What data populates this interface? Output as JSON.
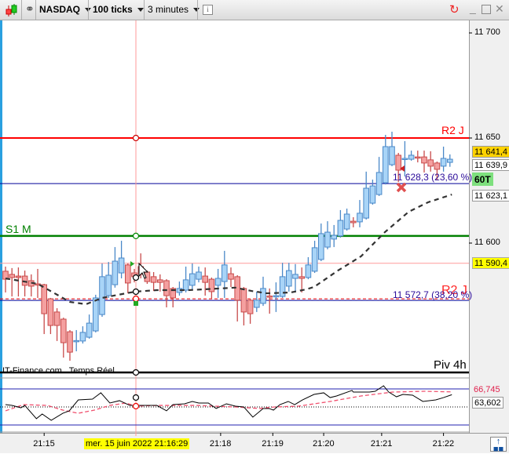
{
  "toolbar": {
    "symbol": "NASDAQ",
    "ticks": "100 ticks",
    "timeframe": "3 minutes",
    "info_icon": "info-icon",
    "icons": [
      "candlestick-icon",
      "link-icon",
      "refresh-icon",
      "minimize-icon",
      "maximize-icon",
      "close-icon"
    ]
  },
  "price_axis": {
    "ticks": [
      {
        "price": 11700,
        "label": "11 700"
      },
      {
        "price": 11650,
        "label": "11 650"
      },
      {
        "price": 11600,
        "label": "11 600"
      }
    ],
    "boxes": [
      {
        "label": "11 641,4",
        "price": 11641.4,
        "color": "#ffd200"
      },
      {
        "label": "11 639,9",
        "price": 11639.9,
        "color": "#ffffff"
      },
      {
        "label": "60T",
        "color": "#7ee07e"
      },
      {
        "label": "11 623,1",
        "price": 11623.1,
        "color": "#ffffff"
      },
      {
        "label": "11 590,4",
        "price": 11590.4,
        "color": "#ffff00"
      }
    ]
  },
  "levels": {
    "r2j": {
      "label": "R2 J",
      "price": 11650,
      "color": "#ff0000"
    },
    "s1m": {
      "label": "S1 M",
      "price": 11603.4,
      "color": "#008000"
    },
    "fib1": {
      "label": "11 628,3 (23,60 %)",
      "price": 11628.3,
      "color": "#000099"
    },
    "fib2": {
      "label": "11 572,7 (38,20 %)",
      "price": 11572.7,
      "color": "#000099"
    },
    "r2j_overlap": {
      "label": "R2 J",
      "color": "#ff0000"
    },
    "piv4h": {
      "label": "Piv 4h",
      "color": "#000000"
    },
    "crosshair_price": 11590.4
  },
  "watermark": "IT-Finance.com   Temps Réel",
  "colors": {
    "up": "#a8d4f7",
    "up_border": "#4a88c8",
    "down": "#f4a0a0",
    "down_border": "#c84a4a",
    "ma": "#333333"
  },
  "candles": [
    [
      11586.6,
      11588.8,
      11576.5,
      11582.8
    ],
    [
      11585.1,
      11588.1,
      11574.6,
      11583.6
    ],
    [
      11584.3,
      11588.4,
      11574.6,
      11583.6
    ],
    [
      11584.3,
      11586.9,
      11574.6,
      11579.9
    ],
    [
      11582.1,
      11585.1,
      11574.6,
      11579.5
    ],
    [
      11580.6,
      11587.7,
      11573.9,
      11580.4
    ],
    [
      11580.2,
      11580.6,
      11556.7,
      11566.4
    ],
    [
      11573.5,
      11573.9,
      11556.7,
      11560.8
    ],
    [
      11567.2,
      11569.0,
      11553.4,
      11560.8
    ],
    [
      11563.8,
      11564.5,
      11545.5,
      11552.6
    ],
    [
      11557.8,
      11558.6,
      11544.0,
      11548.1
    ],
    [
      11553.2,
      11558.6,
      11548.5,
      11553.6
    ],
    [
      11553.4,
      11560.4,
      11552.2,
      11557.5
    ],
    [
      11555.2,
      11566.0,
      11554.5,
      11561.9
    ],
    [
      11558.2,
      11575.4,
      11557.5,
      11573.9
    ],
    [
      11566.0,
      11590.3,
      11564.9,
      11584.0
    ],
    [
      11575.0,
      11591.0,
      11573.9,
      11584.7
    ],
    [
      11580.2,
      11598.1,
      11578.8,
      11591.4
    ],
    [
      11585.8,
      11601.1,
      11583.2,
      11592.9
    ],
    [
      11589.6,
      11590.3,
      11576.1,
      11581.0
    ],
    [
      11585.8,
      11587.7,
      11581.3,
      11584.0
    ],
    [
      11588.8,
      11595.1,
      11583.2,
      11585.1
    ],
    [
      11586.2,
      11586.9,
      11580.6,
      11581.7
    ],
    [
      11584.0,
      11586.2,
      11577.2,
      11581.3
    ],
    [
      11582.5,
      11585.1,
      11576.9,
      11581.3
    ],
    [
      11582.1,
      11582.8,
      11569.4,
      11575.0
    ],
    [
      11578.4,
      11579.1,
      11569.4,
      11573.9
    ],
    [
      11576.5,
      11581.7,
      11575.0,
      11578.4
    ],
    [
      11577.6,
      11588.8,
      11576.5,
      11582.5
    ],
    [
      11579.9,
      11590.3,
      11578.0,
      11585.4
    ],
    [
      11582.8,
      11588.8,
      11581.3,
      11586.2
    ],
    [
      11584.3,
      11588.4,
      11575.0,
      11581.3
    ],
    [
      11582.8,
      11583.6,
      11573.5,
      11576.9
    ],
    [
      11579.9,
      11587.7,
      11573.9,
      11583.2
    ],
    [
      11581.7,
      11596.3,
      11573.9,
      11589.6
    ],
    [
      11585.4,
      11588.4,
      11579.1,
      11582.8
    ],
    [
      11584.0,
      11584.7,
      11562.7,
      11572.8
    ],
    [
      11578.4,
      11579.1,
      11560.8,
      11567.2
    ],
    [
      11572.8,
      11573.5,
      11561.6,
      11566.4
    ],
    [
      11569.4,
      11576.9,
      11567.2,
      11572.8
    ],
    [
      11571.3,
      11584.0,
      11570.1,
      11578.4
    ],
    [
      11574.8,
      11578.4,
      11566.4,
      11574.4
    ],
    [
      11574.4,
      11581.3,
      11567.2,
      11575.0
    ],
    [
      11574.6,
      11590.6,
      11573.9,
      11584.0
    ],
    [
      11579.5,
      11590.6,
      11576.9,
      11586.9
    ],
    [
      11583.2,
      11590.0,
      11576.9,
      11585.1
    ],
    [
      11584.0,
      11588.4,
      11576.5,
      11583.2
    ],
    [
      11583.6,
      11593.3,
      11582.8,
      11589.6
    ],
    [
      11586.6,
      11601.1,
      11585.8,
      11597.8
    ],
    [
      11592.2,
      11609.3,
      11591.4,
      11604.5
    ],
    [
      11598.1,
      11610.4,
      11597.0,
      11605.2
    ],
    [
      11601.9,
      11608.6,
      11598.1,
      11603.7
    ],
    [
      11603.4,
      11615.7,
      11602.6,
      11610.8
    ],
    [
      11606.7,
      11616.4,
      11605.9,
      11613.8
    ],
    [
      11610.4,
      11612.3,
      11607.5,
      11609.7
    ],
    [
      11610.1,
      11620.5,
      11607.5,
      11614.2
    ],
    [
      11611.9,
      11634.0,
      11611.2,
      11626.1
    ],
    [
      11619.0,
      11630.2,
      11618.3,
      11627.2
    ],
    [
      11623.1,
      11641.0,
      11622.4,
      11633.6
    ],
    [
      11628.7,
      11651.5,
      11627.9,
      11645.9
    ],
    [
      11637.3,
      11653.0,
      11636.6,
      11645.9
    ],
    [
      11641.8,
      11642.9,
      11629.1,
      11634.7
    ],
    [
      11639.9,
      11648.5,
      11631.7,
      11640.3
    ],
    [
      11639.9,
      11644.0,
      11639.2,
      11641.8
    ],
    [
      11641.0,
      11644.0,
      11638.4,
      11640.8
    ],
    [
      11641.0,
      11644.0,
      11633.6,
      11638.1
    ],
    [
      11639.6,
      11643.7,
      11634.0,
      11636.6
    ],
    [
      11638.1,
      11638.8,
      11629.9,
      11635.1
    ],
    [
      11636.6,
      11645.9,
      11634.0,
      11640.3
    ],
    [
      11638.4,
      11642.2,
      11636.3,
      11639.9
    ]
  ],
  "moving_average": [
    [
      0,
      11583.2
    ],
    [
      5,
      11580.6
    ],
    [
      10,
      11572.0
    ],
    [
      12.5,
      11570.9
    ],
    [
      15,
      11573.9
    ],
    [
      18.7,
      11576.1
    ],
    [
      20.2,
      11576.9
    ],
    [
      23.5,
      11577.6
    ],
    [
      28.4,
      11577.6
    ],
    [
      35.7,
      11578.8
    ],
    [
      38.2,
      11577.2
    ],
    [
      40.6,
      11576.1
    ],
    [
      44.3,
      11576.5
    ],
    [
      46.7,
      11578.0
    ],
    [
      47.9,
      11579.1
    ],
    [
      51.6,
      11586.9
    ],
    [
      55.2,
      11593.7
    ],
    [
      58.9,
      11605.2
    ],
    [
      62.6,
      11614.9
    ],
    [
      65.6,
      11619.4
    ],
    [
      69.3,
      11623.1
    ]
  ],
  "oscillator": {
    "levels": [
      70,
      50,
      30
    ],
    "value_label": "63,602",
    "signal_label": "66,745",
    "hidden_label": "50",
    "line": [
      [
        0,
        52.6
      ],
      [
        1,
        51.7
      ],
      [
        2.4,
        49.1
      ],
      [
        3,
        51.7
      ],
      [
        4.8,
        37.0
      ],
      [
        5.7,
        42.2
      ],
      [
        7.1,
        35.2
      ],
      [
        8.9,
        43.0
      ],
      [
        9.9,
        45.7
      ],
      [
        11.3,
        57.8
      ],
      [
        13.5,
        58.7
      ],
      [
        14.8,
        65.7
      ],
      [
        16.2,
        54.4
      ],
      [
        17.7,
        57.0
      ],
      [
        19.3,
        51.7
      ],
      [
        23.5,
        51.7
      ],
      [
        25,
        45.7
      ],
      [
        26,
        52.6
      ],
      [
        27.8,
        53.5
      ],
      [
        29,
        56.1
      ],
      [
        30,
        54.4
      ],
      [
        31.5,
        54.4
      ],
      [
        32.7,
        48.3
      ],
      [
        34.3,
        53.5
      ],
      [
        35.7,
        50.9
      ],
      [
        37,
        50
      ],
      [
        38.4,
        38.7
      ],
      [
        40,
        48.3
      ],
      [
        40.9,
        48.3
      ],
      [
        41.6,
        46.5
      ],
      [
        42.6,
        52.6
      ],
      [
        43.9,
        56.1
      ],
      [
        44.9,
        52.6
      ],
      [
        46.1,
        57.8
      ],
      [
        47.9,
        63.9
      ],
      [
        49.4,
        65.7
      ],
      [
        50.4,
        60.4
      ],
      [
        51.4,
        62.2
      ],
      [
        53.8,
        68.3
      ],
      [
        54,
        66.5
      ],
      [
        56.5,
        66.5
      ],
      [
        57.4,
        67.4
      ],
      [
        58.7,
        73.5
      ],
      [
        59.5,
        66.5
      ],
      [
        60.7,
        61.3
      ],
      [
        61.7,
        63.9
      ],
      [
        63.2,
        63.1
      ],
      [
        64.8,
        56.1
      ],
      [
        66.8,
        57.8
      ],
      [
        68,
        60.4
      ],
      [
        69.3,
        63.6
      ]
    ],
    "signal": [
      [
        0,
        45.7
      ],
      [
        2.8,
        52.6
      ],
      [
        6.5,
        51.7
      ],
      [
        8.9,
        46.5
      ],
      [
        11.3,
        43.0
      ],
      [
        13.8,
        46.5
      ],
      [
        16.2,
        51.7
      ],
      [
        18.7,
        54.4
      ],
      [
        20.2,
        50.9
      ],
      [
        23.5,
        51.7
      ],
      [
        29.6,
        51.7
      ],
      [
        35.7,
        50
      ],
      [
        39.4,
        48.3
      ],
      [
        41.8,
        50
      ],
      [
        45.5,
        50.9
      ],
      [
        50.4,
        56.1
      ],
      [
        55.2,
        62.2
      ],
      [
        60.1,
        66.5
      ],
      [
        65,
        67.4
      ],
      [
        69.3,
        66.7
      ]
    ]
  },
  "time_axis": {
    "labels": [
      {
        "label": "21:15",
        "index": 6
      },
      {
        "label": "21:18",
        "index": 33.4
      },
      {
        "label": "21:19",
        "index": 41.5
      },
      {
        "label": "21:20",
        "index": 49.4
      },
      {
        "label": "21:21",
        "index": 58.4
      },
      {
        "label": "21:22",
        "index": 68
      }
    ],
    "cursor_label": "mer. 15 juin 2022 21:16:29"
  }
}
